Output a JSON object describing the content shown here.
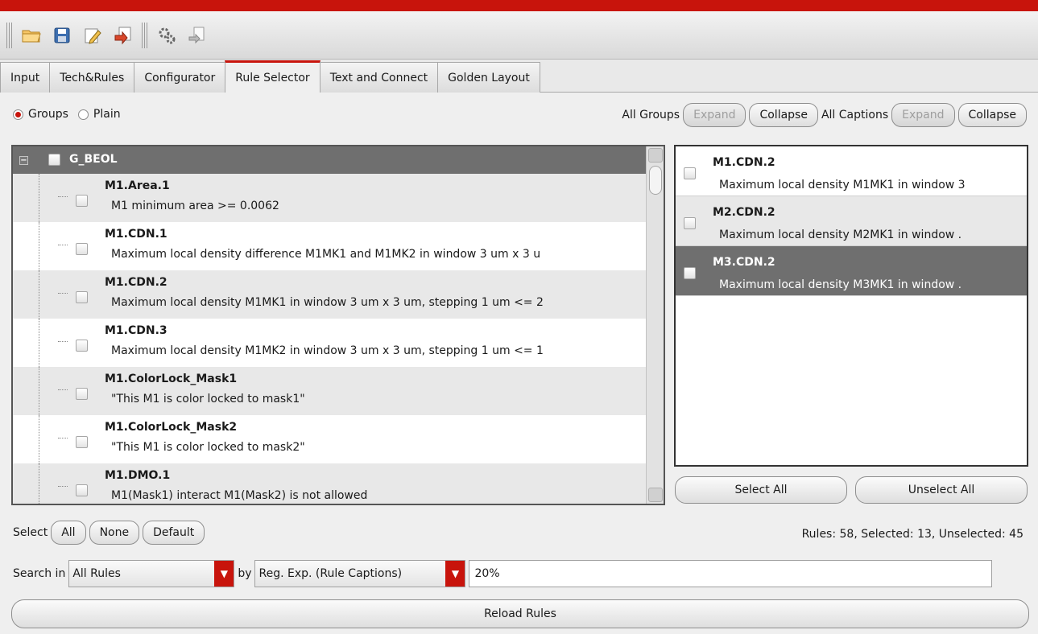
{
  "toolbar": {
    "icons": [
      "open-folder-icon",
      "save-icon",
      "edit-icon",
      "export-icon",
      "settings-gears-icon",
      "transfer-icon"
    ]
  },
  "tabs": [
    {
      "label": "Input",
      "active": false
    },
    {
      "label": "Tech&Rules",
      "active": false
    },
    {
      "label": "Configurator",
      "active": false
    },
    {
      "label": "Rule Selector",
      "active": true
    },
    {
      "label": "Text and Connect",
      "active": false
    },
    {
      "label": "Golden Layout",
      "active": false
    }
  ],
  "view_mode": {
    "groups_label": "Groups",
    "plain_label": "Plain",
    "selected": "Groups"
  },
  "group_controls": {
    "all_groups_label": "All Groups",
    "expand_label": "Expand",
    "collapse_label": "Collapse",
    "all_captions_label": "All Captions",
    "captions_expand_label": "Expand",
    "captions_collapse_label": "Collapse"
  },
  "rule_tree": {
    "group_name": "G_BEOL",
    "rules": [
      {
        "name": "M1.Area.1",
        "caption": "M1 minimum area >= 0.0062"
      },
      {
        "name": "M1.CDN.1",
        "caption": "Maximum local density difference M1MK1 and M1MK2 in window 3 um x 3 u"
      },
      {
        "name": "M1.CDN.2",
        "caption": "Maximum local density  M1MK1 in window 3 um x 3 um, stepping 1 um <= 2"
      },
      {
        "name": "M1.CDN.3",
        "caption": "Maximum local density  M1MK2 in window 3 um x 3 um, stepping 1 um <= 1"
      },
      {
        "name": "M1.ColorLock_Mask1",
        "caption": "\"This M1 is color locked to mask1\""
      },
      {
        "name": "M1.ColorLock_Mask2",
        "caption": "\"This M1 is color locked to mask2\""
      },
      {
        "name": "M1.DMO.1",
        "caption": "M1(Mask1) interact M1(Mask2) is not allowed"
      }
    ]
  },
  "selected_rules": [
    {
      "name": "M1.CDN.2",
      "caption": "Maximum local density  M1MK1 in window 3"
    },
    {
      "name": "M2.CDN.2",
      "caption": "Maximum local density  M2MK1 in window ."
    },
    {
      "name": "M3.CDN.2",
      "caption": "Maximum local density  M3MK1 in window ."
    }
  ],
  "selection_buttons": {
    "select_all_label": "Select All",
    "unselect_all_label": "Unselect All"
  },
  "select_row": {
    "select_label": "Select",
    "all_label": "All",
    "none_label": "None",
    "default_label": "Default"
  },
  "counts_text": "Rules: 58, Selected: 13, Unselected: 45",
  "search": {
    "search_in_label": "Search in",
    "search_in_value": "All Rules",
    "by_label": "by",
    "by_value": "Reg. Exp. (Rule Captions)",
    "query": "20%"
  },
  "reload_label": "Reload Rules",
  "colors": {
    "accent": "#c8140c",
    "group_row": "#6f6f6f",
    "alt_row": "#e8e8e8"
  }
}
